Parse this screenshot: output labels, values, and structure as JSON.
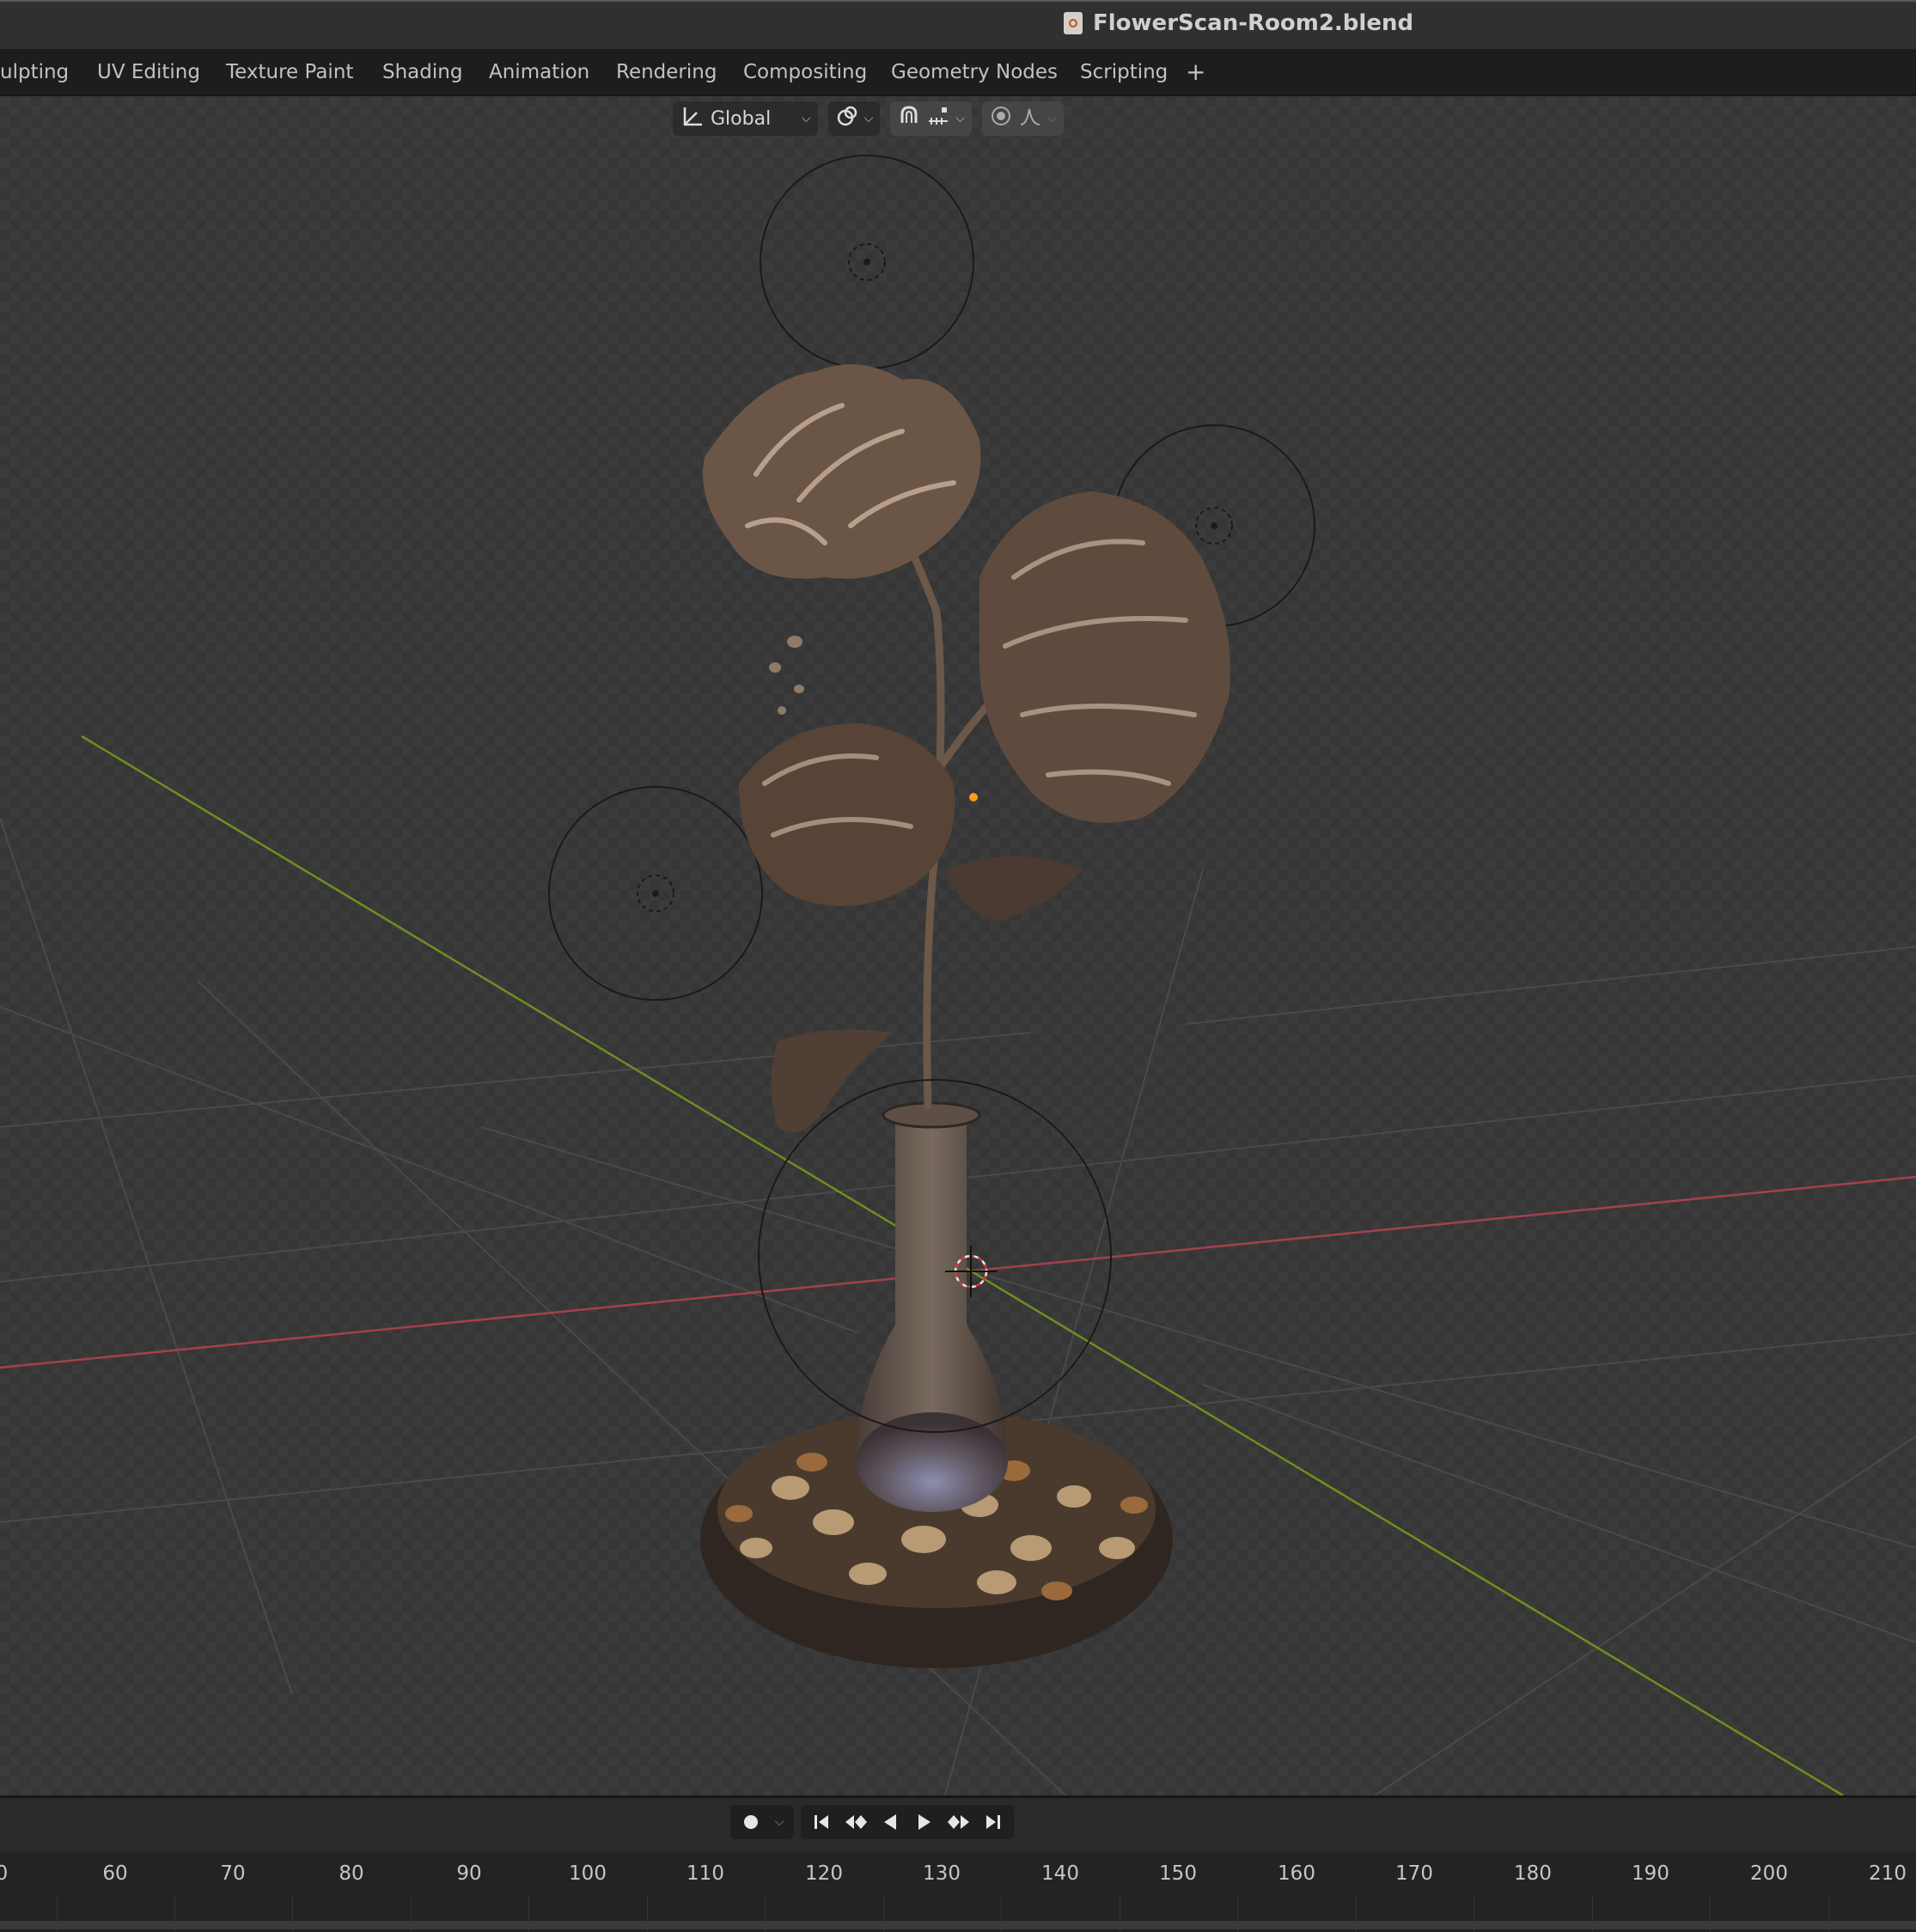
{
  "window": {
    "title": "FlowerScan-Room2.blend",
    "file_icon": "blend-file-icon"
  },
  "workspace_tabs": [
    "ulpting",
    "UV Editing",
    "Texture Paint",
    "Shading",
    "Animation",
    "Rendering",
    "Compositing",
    "Geometry Nodes",
    "Scripting",
    "+"
  ],
  "viewport_header": {
    "transform_orientation": "Global",
    "pivot_icon": "pivot-point-icon",
    "snap_icon": "snap-magnet-icon",
    "snap_target_icon": "snap-increment-icon",
    "proportional_icon": "proportional-editing-icon",
    "falloff_icon": "falloff-curve-icon"
  },
  "scene": {
    "axis_colors": {
      "x_axis": "#a3414d",
      "y_axis": "#6e8f1f"
    },
    "object": "flower-vase-scan",
    "selected_origin_color": "#ff9a1a",
    "light_count": 4
  },
  "timeline": {
    "playback_buttons": [
      "record-icon",
      "jump-start-icon",
      "prev-keyframe-icon",
      "play-reverse-icon",
      "play-icon",
      "next-keyframe-icon",
      "jump-end-icon"
    ],
    "frame_ticks": [
      "0",
      "60",
      "70",
      "80",
      "90",
      "100",
      "110",
      "120",
      "130",
      "140",
      "150",
      "160",
      "170",
      "180",
      "190",
      "200",
      "210"
    ]
  }
}
